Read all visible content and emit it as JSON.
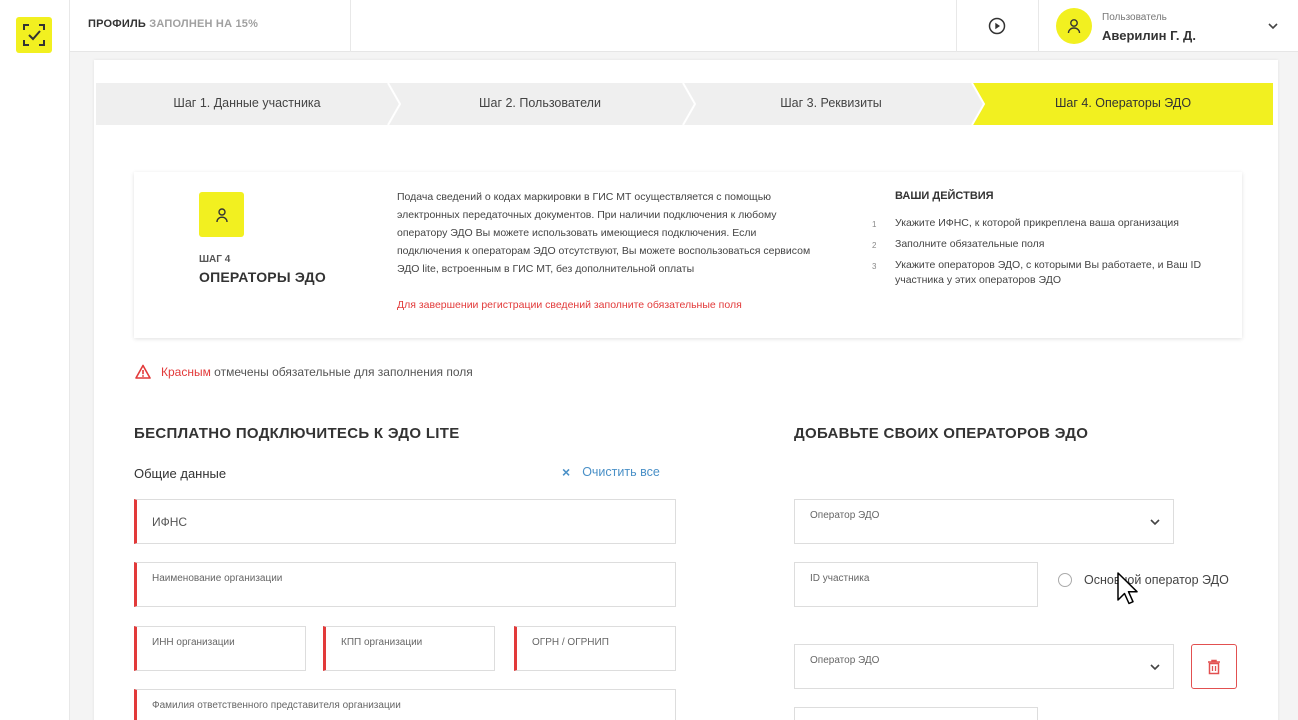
{
  "header": {
    "profile_label": "ПРОФИЛЬ",
    "profile_status": "ЗАПОЛНЕН НА 15%",
    "user_role": "Пользователь",
    "user_name": "Аверилин Г. Д."
  },
  "steps": [
    {
      "label": "Шаг 1. Данные участника",
      "active": false
    },
    {
      "label": "Шаг 2. Пользователи",
      "active": false
    },
    {
      "label": "Шаг 3. Реквизиты",
      "active": false
    },
    {
      "label": "Шаг 4. Операторы ЭДО",
      "active": true
    }
  ],
  "info": {
    "step_num": "ШАГ 4",
    "step_title": "ОПЕРАТОРЫ ЭДО",
    "description": "Подача сведений о кодах маркировки в ГИС МТ осуществляется с помощью электронных передаточных документов. При наличии подключения к любому оператору ЭДО Вы можете использовать имеющиеся подключения. Если подключения к операторам ЭДО отсутствуют, Вы можете воспользоваться сервисом ЭДО lite, встроенным в ГИС МТ, без дополнительной оплаты",
    "warning": "Для завершении регистрации сведений заполните обязательные поля",
    "actions_title": "ВАШИ ДЕЙСТВИЯ",
    "actions": [
      {
        "num": "1",
        "text": "Укажите ИФНС, к которой прикреплена ваша организация"
      },
      {
        "num": "2",
        "text": "Заполните обязательные поля"
      },
      {
        "num": "3",
        "text": "Укажите операторов ЭДО, с которыми Вы работаете, и Ваш ID участника у этих операторов ЭДО"
      }
    ]
  },
  "notice": {
    "red_word": "Красным",
    "rest": " отмечены обязательные для заполнения поля"
  },
  "left": {
    "title": "БЕСПЛАТНО ПОДКЛЮЧИТЕСЬ К ЭДО LITE",
    "subtitle": "Общие данные",
    "clear_all": "Очистить все",
    "fields": {
      "ifns": "ИФНС",
      "org_name": "Наименование организации",
      "inn": "ИНН организации",
      "kpp": "КПП организации",
      "ogrn": "ОГРН / ОГРНИП",
      "rep_surname": "Фамилия ответственного представителя организации"
    }
  },
  "right": {
    "title": "ДОБАВЬТЕ СВОИХ ОПЕРАТОРОВ ЭДО",
    "operator_label": "Оператор ЭДО",
    "participant_id_label": "ID участника",
    "main_operator_label": "Основной оператор ЭДО"
  },
  "colors": {
    "accent_yellow": "#f2f020",
    "required_red": "#e23a3a",
    "link_blue": "#4a90c7"
  }
}
